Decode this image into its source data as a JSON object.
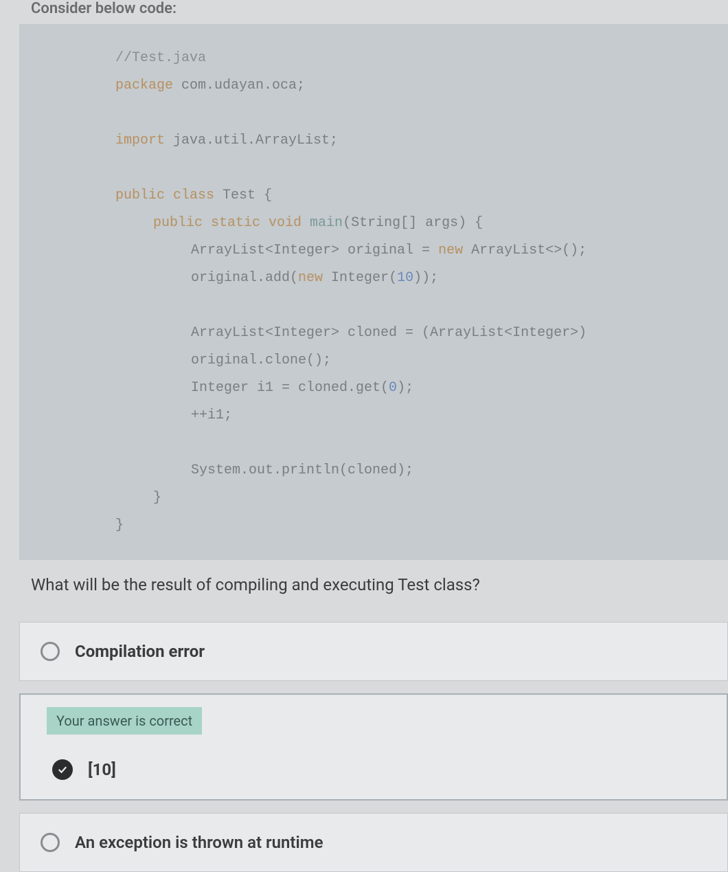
{
  "intro": "Consider below code:",
  "code": {
    "line1_comment": "//Test.java",
    "line2_keyword": "package",
    "line2_rest": " com.udayan.oca;",
    "line3_keyword": "import",
    "line3_rest": " java.util.ArrayList;",
    "line4_keyword": "public class",
    "line4_type": " Test",
    "line4_rest": " {",
    "line5_keyword": "public static void",
    "line5_method": " main",
    "line5_rest": "(String[] args) {",
    "line6_text": "ArrayList<Integer> original = ",
    "line6_keyword": "new",
    "line6_rest": " ArrayList<>();",
    "line7_text": "original.add(",
    "line7_keyword": "new",
    "line7_rest": " Integer(",
    "line7_num": "10",
    "line7_end": "));",
    "line8_text": "ArrayList<Integer> cloned = (ArrayList<Integer>) original.clone();",
    "line9_text": "Integer i1 = cloned.get(",
    "line9_num": "0",
    "line9_end": ");",
    "line10_text": "++i1;",
    "line11_text": "System.out.println(cloned);",
    "line12_text": "}",
    "line13_text": "}"
  },
  "question": "What will be the result of compiling and executing Test class?",
  "options": {
    "a": "Compilation error",
    "b_badge": "Your answer is correct",
    "b": "[10]",
    "c": "An exception is thrown at runtime"
  }
}
